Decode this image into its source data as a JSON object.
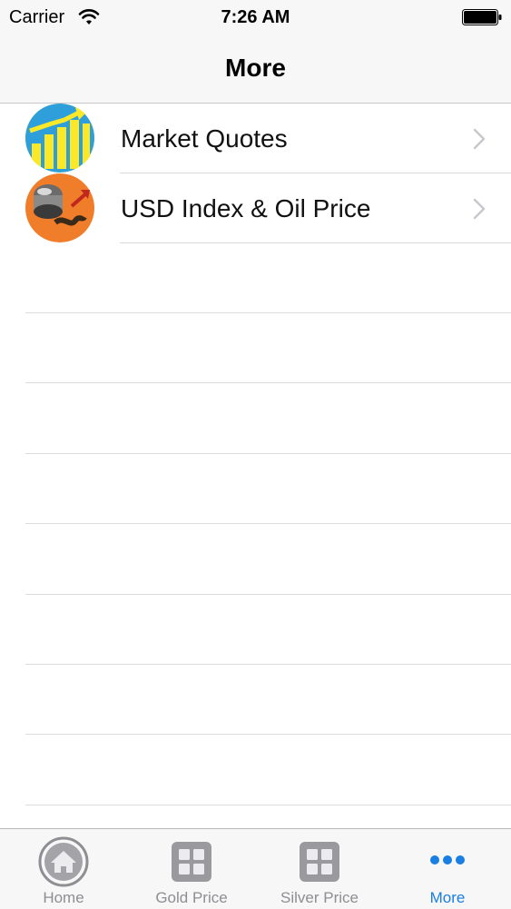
{
  "status_bar": {
    "carrier": "Carrier",
    "time": "7:26 AM",
    "wifi_icon": "wifi-icon",
    "battery_icon": "battery-icon"
  },
  "nav": {
    "title": "More"
  },
  "rows": [
    {
      "label": "Market Quotes",
      "icon": "market-quotes-chart-icon"
    },
    {
      "label": "USD Index & Oil Price",
      "icon": "oil-barrel-icon"
    }
  ],
  "tabs": [
    {
      "label": "Home",
      "icon": "home-icon",
      "active": false
    },
    {
      "label": "Gold Price",
      "icon": "grid-icon",
      "active": false
    },
    {
      "label": "Silver Price",
      "icon": "grid-icon",
      "active": false
    },
    {
      "label": "More",
      "icon": "more-dots-icon",
      "active": true
    }
  ],
  "colors": {
    "accent": "#1a7ee2",
    "inactive_tab": "#8e8e93",
    "bar_background": "#f7f7f7",
    "separator": "#d9d9dc"
  }
}
